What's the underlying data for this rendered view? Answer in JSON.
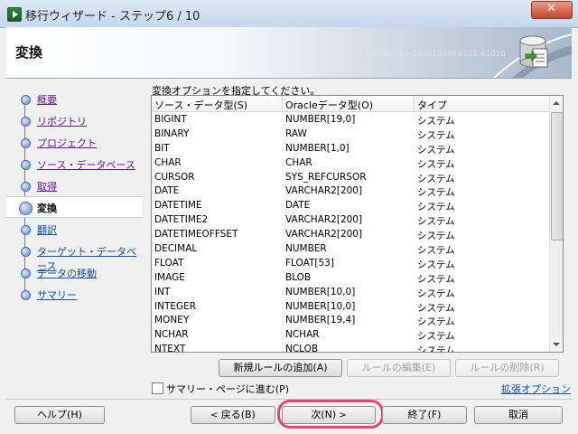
{
  "window": {
    "title": "移行ウィザード - ステップ6 / 10"
  },
  "header": {
    "title": "変換",
    "bits": "01010101010 1010101010101 01010"
  },
  "nav": [
    {
      "label": "概要",
      "state": "done"
    },
    {
      "label": "リポジトリ",
      "state": "done"
    },
    {
      "label": "プロジェクト",
      "state": "done"
    },
    {
      "label": "ソース・データベース",
      "state": "done"
    },
    {
      "label": "取得",
      "state": "done"
    },
    {
      "label": "変換",
      "state": "current"
    },
    {
      "label": "翻訳",
      "state": "future"
    },
    {
      "label": "ターゲット・データベース",
      "state": "future"
    },
    {
      "label": "データの移動",
      "state": "future"
    },
    {
      "label": "サマリー",
      "state": "future"
    }
  ],
  "main": {
    "instruction": "変換オプションを指定してください。",
    "columns": [
      "ソース・データ型(S)",
      "Oracleデータ型(O)",
      "タイプ"
    ],
    "rows": [
      [
        "BIGINT",
        "NUMBER[19,0]",
        "システム"
      ],
      [
        "BINARY",
        "RAW",
        "システム"
      ],
      [
        "BIT",
        "NUMBER[1,0]",
        "システム"
      ],
      [
        "CHAR",
        "CHAR",
        "システム"
      ],
      [
        "CURSOR",
        "SYS_REFCURSOR",
        "システム"
      ],
      [
        "DATE",
        "VARCHAR2[200]",
        "システム"
      ],
      [
        "DATETIME",
        "DATE",
        "システム"
      ],
      [
        "DATETIME2",
        "VARCHAR2[200]",
        "システム"
      ],
      [
        "DATETIMEOFFSET",
        "VARCHAR2[200]",
        "システム"
      ],
      [
        "DECIMAL",
        "NUMBER",
        "システム"
      ],
      [
        "FLOAT",
        "FLOAT[53]",
        "システム"
      ],
      [
        "IMAGE",
        "BLOB",
        "システム"
      ],
      [
        "INT",
        "NUMBER[10,0]",
        "システム"
      ],
      [
        "INTEGER",
        "NUMBER[10,0]",
        "システム"
      ],
      [
        "MONEY",
        "NUMBER[19,4]",
        "システム"
      ],
      [
        "NCHAR",
        "NCHAR",
        "システム"
      ],
      [
        "NTEXT",
        "NCLOB",
        "システム"
      ]
    ],
    "add_rule": "新規ルールの追加(A)",
    "edit_rule": "ルールの編集(E)",
    "delete_rule": "ルールの削除(R)",
    "skip_to_summary": "サマリー・ページに進む(P)",
    "advanced_options": "拡張オプション"
  },
  "footer": {
    "help": "ヘルプ(H)",
    "back": "戻る(B)",
    "next": "次(N)",
    "finish": "終了(F)",
    "cancel": "取消"
  }
}
